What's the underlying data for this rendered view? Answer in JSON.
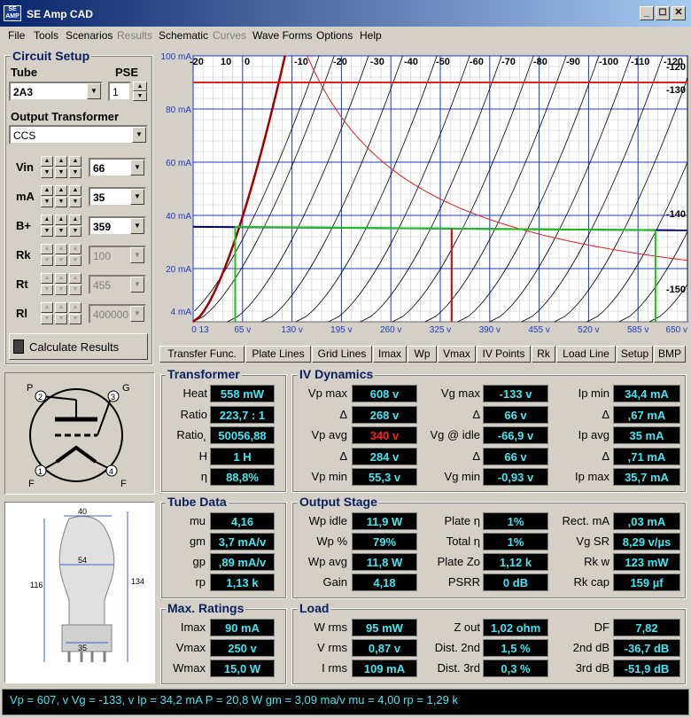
{
  "window": {
    "title": "SE Amp CAD",
    "app_icon_text": "SE\nAMP",
    "controls": [
      "_",
      "☐",
      "✕"
    ]
  },
  "menu": [
    {
      "label": "File",
      "enabled": true
    },
    {
      "label": "Tools",
      "enabled": true
    },
    {
      "label": "Scenarios",
      "enabled": true
    },
    {
      "label": "Results",
      "enabled": false
    },
    {
      "label": "Schematic",
      "enabled": true
    },
    {
      "label": "Curves",
      "enabled": false
    },
    {
      "label": "Wave Forms",
      "enabled": true
    },
    {
      "label": "Options",
      "enabled": true
    },
    {
      "label": "Help",
      "enabled": true
    }
  ],
  "setup": {
    "title": "Circuit Setup",
    "tube_label": "Tube",
    "tube_value": "2A3",
    "pse_label": "PSE",
    "pse_value": "1",
    "ot_label": "Output Transformer",
    "ot_value": "CCS",
    "params": [
      {
        "label": "Vin",
        "value": "66",
        "enabled": true
      },
      {
        "label": "mA",
        "value": "35",
        "enabled": true
      },
      {
        "label": "B+",
        "value": "359",
        "enabled": true
      },
      {
        "label": "Rk",
        "value": "100",
        "enabled": false
      },
      {
        "label": "Rt",
        "value": "455",
        "enabled": false
      },
      {
        "label": "Rl",
        "value": "400000",
        "enabled": false
      }
    ],
    "calc_label": "Calculate Results"
  },
  "chart_data": {
    "type": "line",
    "y_ticks": [
      "100 mA",
      "80 mA",
      "60 mA",
      "40 mA",
      "20 mA",
      "4 mA"
    ],
    "x_ticks": [
      "0 13",
      "65 v",
      "130 v",
      "195 v",
      "260 v",
      "325 v",
      "390 v",
      "455 v",
      "520 v",
      "585 v",
      "650 v"
    ],
    "xlim": [
      0,
      650
    ],
    "ylim": [
      0,
      100
    ],
    "grid_labels_top": [
      "-20",
      "10",
      "0",
      "-10",
      "-20",
      "-30",
      "-40",
      "-50",
      "-60",
      "-70",
      "-80",
      "-90",
      "-100",
      "-110",
      "-120"
    ],
    "grid_labels_right": [
      "-130",
      "-140",
      "-150"
    ],
    "grid_curves": [
      {
        "vg": 10,
        "v0": -20
      },
      {
        "vg": 0,
        "v0": 0
      },
      {
        "vg": -10,
        "v0": 45
      },
      {
        "vg": -20,
        "v0": 90
      },
      {
        "vg": -30,
        "v0": 135
      },
      {
        "vg": -40,
        "v0": 178
      },
      {
        "vg": -50,
        "v0": 220
      },
      {
        "vg": -60,
        "v0": 262
      },
      {
        "vg": -70,
        "v0": 305
      },
      {
        "vg": -80,
        "v0": 348
      },
      {
        "vg": -90,
        "v0": 390
      },
      {
        "vg": -100,
        "v0": 432
      },
      {
        "vg": -110,
        "v0": 475
      },
      {
        "vg": -120,
        "v0": 518
      },
      {
        "vg": -130,
        "v0": 560
      },
      {
        "vg": -140,
        "v0": 600
      }
    ],
    "max_current_line_mA": 90,
    "operating_point": {
      "mA": 35,
      "v_idle": 340
    },
    "load_line_mA": [
      34.4,
      35.7
    ],
    "load_line_v": [
      55.3,
      608
    ],
    "pd_curve_watts": 15,
    "red_curve_zero_bias": true
  },
  "tabs": [
    "Transfer Func.",
    "Plate Lines",
    "Grid Lines",
    "Imax",
    "Wp",
    "Vmax",
    "IV Points",
    "Rk",
    "Load Line",
    "Setup",
    "BMP"
  ],
  "tube_schematic": {
    "pins": [
      "P",
      "G",
      "3",
      "1",
      "4",
      "2",
      "F",
      "F"
    ]
  },
  "dimensions": {
    "width": "40",
    "neck": "54",
    "height1": "116",
    "height2": "134",
    "base": "35"
  },
  "transformer": {
    "title": "Transformer",
    "rows": [
      {
        "label": "Heat",
        "value": "558 mW"
      },
      {
        "label": "Ratio",
        "value": "223,7 : 1"
      },
      {
        "label": "Ratio˛",
        "value": "50056,88"
      },
      {
        "label": "H",
        "value": "1 H"
      },
      {
        "label": "η",
        "value": "88,8%"
      }
    ]
  },
  "iv": {
    "title": "IV Dynamics",
    "col1": [
      {
        "label": "Vp max",
        "value": "608 v"
      },
      {
        "label": "Δ",
        "value": "268 v"
      },
      {
        "label": "Vp avg",
        "value": "340 v",
        "red": true
      },
      {
        "label": "Δ",
        "value": "284 v"
      },
      {
        "label": "Vp min",
        "value": "55,3 v"
      }
    ],
    "col2": [
      {
        "label": "Vg max",
        "value": "-133 v"
      },
      {
        "label": "Δ",
        "value": "66 v"
      },
      {
        "label": "Vg @ idle",
        "value": "-66,9 v"
      },
      {
        "label": "Δ",
        "value": "66 v"
      },
      {
        "label": "Vg min",
        "value": "-0,93 v"
      }
    ],
    "col3": [
      {
        "label": "Ip min",
        "value": "34,4 mA"
      },
      {
        "label": "Δ",
        "value": ",67 mA"
      },
      {
        "label": "Ip avg",
        "value": "35 mA"
      },
      {
        "label": "Δ",
        "value": ",71 mA"
      },
      {
        "label": "Ip max",
        "value": "35,7 mA"
      }
    ]
  },
  "tube_data": {
    "title": "Tube Data",
    "rows": [
      {
        "label": "mu",
        "value": "4,16"
      },
      {
        "label": "gm",
        "value": "3,7 mA/v"
      },
      {
        "label": "gp",
        "value": ",89 mA/v"
      },
      {
        "label": "rp",
        "value": "1,13 k"
      }
    ]
  },
  "output_stage": {
    "title": "Output Stage",
    "col1": [
      {
        "label": "Wp idle",
        "value": "11,9 W"
      },
      {
        "label": "Wp %",
        "value": "79%"
      },
      {
        "label": "Wp avg",
        "value": "11,8 W"
      },
      {
        "label": "Gain",
        "value": "4,18"
      }
    ],
    "col2": [
      {
        "label": "Plate η",
        "value": "1%"
      },
      {
        "label": "Total η",
        "value": "1%"
      },
      {
        "label": "Plate Zo",
        "value": "1,12 k"
      },
      {
        "label": "PSRR",
        "value": "0 dB"
      }
    ],
    "col3": [
      {
        "label": "Rect. mA",
        "value": ",03 mA"
      },
      {
        "label": "Vg SR",
        "value": "8,29 v/µs"
      },
      {
        "label": "Rk w",
        "value": "123 mW"
      },
      {
        "label": "Rk cap",
        "value": "159 µf"
      }
    ]
  },
  "max_ratings": {
    "title": "Max. Ratings",
    "rows": [
      {
        "label": "Imax",
        "value": "90 mA"
      },
      {
        "label": "Vmax",
        "value": "250 v"
      },
      {
        "label": "Wmax",
        "value": "15,0 W"
      }
    ]
  },
  "load": {
    "title": "Load",
    "col1": [
      {
        "label": "W rms",
        "value": "95 mW"
      },
      {
        "label": "V rms",
        "value": "0,87 v"
      },
      {
        "label": "I rms",
        "value": "109 mA"
      }
    ],
    "col2": [
      {
        "label": "Z out",
        "value": "1,02 ohm"
      },
      {
        "label": "Dist. 2nd",
        "value": "1,5 %"
      },
      {
        "label": "Dist. 3rd",
        "value": "0,3 %"
      }
    ],
    "col3": [
      {
        "label": "DF",
        "value": "7,82"
      },
      {
        "label": "2nd dB",
        "value": "-36,7 dB"
      },
      {
        "label": "3rd dB",
        "value": "-51,9 dB"
      }
    ]
  },
  "status": "Vp =  607, v   Vg = -133, v   Ip = 34,2 mA     P = 20,8 W   gm = 3,09 ma/v    mu = 4,00    rp = 1,29 k"
}
